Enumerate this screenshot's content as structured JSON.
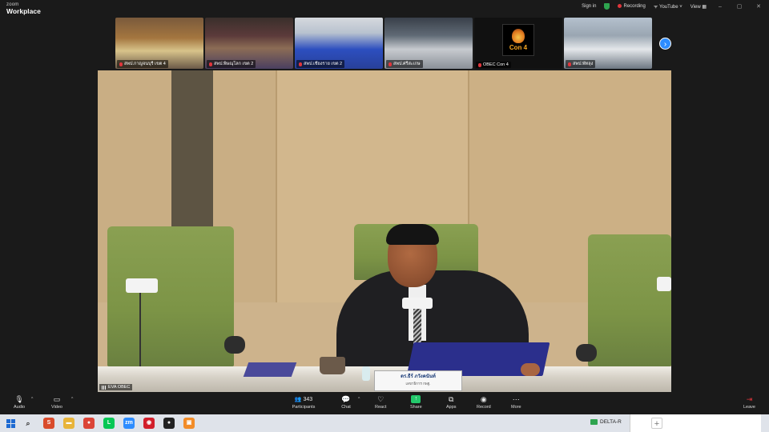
{
  "app": {
    "brand_top": "zoom",
    "brand_bottom": "Workplace"
  },
  "titlebar": {
    "sign_in": "Sign in",
    "recording": "Recording",
    "youtube": "YouTube",
    "view": "View",
    "window_controls": [
      "–",
      "▢",
      "✕"
    ]
  },
  "thumbnails": [
    {
      "name": "สพป.กาญจนบุรี เขต 4"
    },
    {
      "name": "สพป.พิษณุโลก เขต 2"
    },
    {
      "name": "สพป.เชียงราย เขต 2"
    },
    {
      "name": "สพป.ศรีสะเกษ"
    },
    {
      "name": "OBEC Con 4",
      "logo_text": "Con 4"
    },
    {
      "name": "สพป.พัทลุง"
    }
  ],
  "thumbnail_next": "›",
  "main_video": {
    "label": "EVA OBEC",
    "speaker_name": "ดร.ธีร์ ภวังคนันท์",
    "speaker_title": "เลขาธิการ กพฐ."
  },
  "toolbar": {
    "audio": "Audio",
    "video": "Video",
    "participants_count": "343",
    "participants": "Participants",
    "chat": "Chat",
    "react": "React",
    "share": "Share",
    "apps": "Apps",
    "record": "Record",
    "more": "More",
    "leave": "Leave"
  },
  "taskbar": {
    "tray_label": "DELTA-R",
    "app_icons": [
      {
        "name": "files-icon",
        "color": "#d94b2b",
        "glyph": "S"
      },
      {
        "name": "folder-icon",
        "color": "#e8b43a",
        "glyph": "▬"
      },
      {
        "name": "chrome-icon",
        "color": "#db4437",
        "glyph": "●"
      },
      {
        "name": "line-icon",
        "color": "#06c755",
        "glyph": "L"
      },
      {
        "name": "zoom-icon",
        "color": "#2d8cff",
        "glyph": "zm"
      },
      {
        "name": "app-red-icon",
        "color": "#d21f2b",
        "glyph": "◉"
      },
      {
        "name": "app-dark-icon",
        "color": "#222222",
        "glyph": "●"
      },
      {
        "name": "app-orange-icon",
        "color": "#f28c28",
        "glyph": "▣"
      }
    ]
  }
}
